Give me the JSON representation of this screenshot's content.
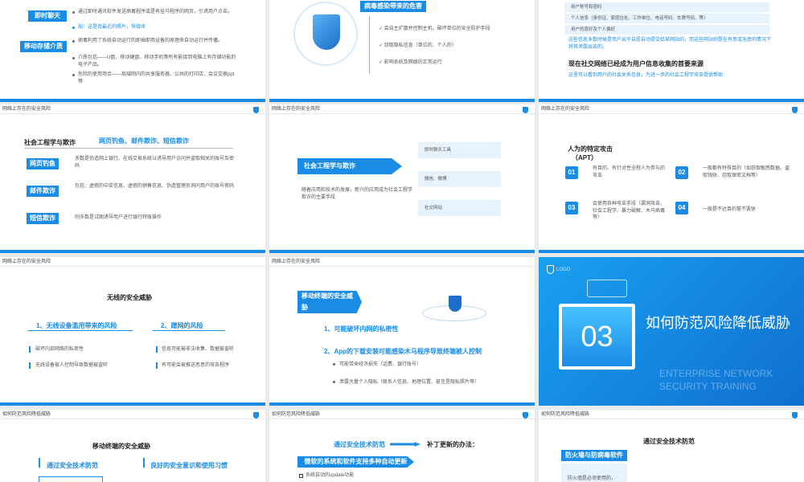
{
  "s1": {
    "tag1": "即时聊天",
    "text1": "通过即时通讯软件发送病毒程序或是有挂马程序的网页，引诱用户点击。",
    "text2": "如：这是我最近的照片，快接收",
    "tag2": "移动存储介质",
    "text3": "病毒利用了系统自动运行的即插即用设备的原理来自动运行并传播。",
    "text4": "介质包括——U盘、移动硬盘、移动手机等所有能接到电脑上有存储功能的电子产品。",
    "text5": "危险的使用场合——局域网内的共享服务器、公共的打印店、会议交换ppt等"
  },
  "s2": {
    "tag": "病毒感染带来的危害",
    "items": [
      "会自主扩散并控制主机，破坏单位的安全防护手段",
      "窃取隐私信息（单位的、个人的）",
      "影响系统及网络的正常运行"
    ]
  },
  "s3": {
    "box1": "用户账号和密码",
    "box2": "个人信息（身份证、家庭住址、工作单位、电话号码、车牌号码、等）",
    "box3": "用户的喜好及个人偏好",
    "note1": "这些信息多数时候是用户出于自愿自动提交给某网站的，而这些网站则是在有意或无意的情况下将其泄露出去的。",
    "title": "现在社交网络已经成为用户信息收集的首要来源",
    "note2": "这里可以看到用户的社会关系信息，为进一步的社会工程学攻击提供帮助"
  },
  "s4": {
    "header": "网络上存在的安全风险",
    "title": "社会工程学与欺诈",
    "subtitle": "网页钓鱼、邮件欺诈、短信欺诈",
    "tag1": "网页钓鱼",
    "text1": "多数是伪造网上银行、在线交易系统以诱导用户访问并盗取相关的账号及密码",
    "tag2": "邮件欺诈",
    "text2": "包括：虚假的中奖信息、虚假的销售信息、伪造管理员询问用户的账号密码",
    "tag3": "短信欺诈",
    "text3": "则多数是试图诱导用户进行银行转账操作"
  },
  "s5": {
    "header": "网络上存在的安全风险",
    "arrow": "社会工程学与欺诈",
    "text": "随着应用和技术的发展，新兴的应用成为社会工程学欺诈的主要手段",
    "boxes": [
      "即时聊天工具",
      "微信、微博",
      "社交网站"
    ]
  },
  "s6": {
    "header": "网络上存在的安全风险",
    "title": "人为的特定攻击",
    "subtitle": "（APT）",
    "n1": "01",
    "t1": "有目的、有针对性全程人为参与的攻击",
    "n2": "02",
    "t2": "一般都有特殊目的（如获取敏感数据、盗取钱财、窃取保密文档等）",
    "n3": "03",
    "t3": "会使用各种攻击手段（漏洞攻击、社会工程学、暴力破解、木马病毒等）",
    "n4": "04",
    "t4": "一般是不达目的誓不罢休"
  },
  "s7": {
    "header": "网络上存在的安全风险",
    "title": "无线的安全威胁",
    "h1": "1、无线设备滥用带来的风险",
    "h2": "2、蹭网的风险",
    "l1": "破坏内部网络的私密性",
    "l2": "无线设备被人控制导致数据被盗听",
    "r1": "信息可能被非法收集、数据被盗听",
    "r2": "有可能会被推送恶意的攻击程序"
  },
  "s8": {
    "header": "网络上存在的安全风险",
    "tag": "移动终端的安全威胁",
    "p1": "1、可能破坏内网的私密性",
    "p2": "2、App的下载安装可能感染木马程序导致终端被人控制",
    "b1": "可能带来经济损失（话费、银行账号）",
    "b2": "泄露大量个人隐私（联系人信息、地理位置、甚至是隐私照片等）"
  },
  "s9": {
    "logo": "LOGO",
    "number": "03",
    "title": "如何防范风险降低威胁",
    "en1": "ENTERPRISE NETWORK",
    "en2": "SECURITY TRAINING"
  },
  "s10": {
    "header": "如何防范风险降低威胁",
    "title": "移动终端的安全威胁",
    "h1": "通过安全技术防范",
    "h2": "良好的安全意识和使用习惯"
  },
  "s11": {
    "header": "如何防范风险降低威胁",
    "title": "通过安全技术防范",
    "sub": "补丁更新的办法：",
    "tag": "微软的系统和软件支持多种自动更新",
    "item": "系统自动的update功能"
  },
  "s12": {
    "header": "如何防范风险降低威胁",
    "title": "通过安全技术防范",
    "tag": "防火墙与防病毒软件",
    "text": "防火墙是必须使用的，"
  }
}
